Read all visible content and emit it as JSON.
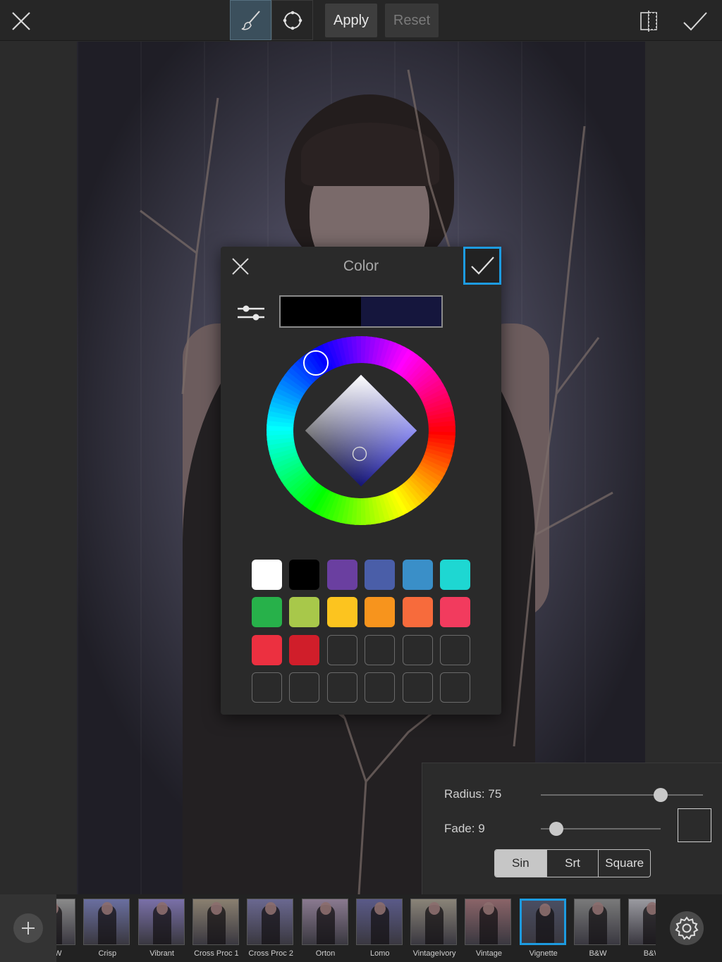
{
  "toolbar": {
    "apply_label": "Apply",
    "reset_label": "Reset",
    "active_tool": "brush-icon"
  },
  "color_dialog": {
    "title": "Color",
    "old_color": "#000000",
    "new_color": "#15163d",
    "swatches": [
      "#ffffff",
      "#000000",
      "#6a3fa0",
      "#4a5ea8",
      "#3a8fc8",
      "#1ed7d2",
      "#27b14a",
      "#a8c84a",
      "#fcc41f",
      "#f7941d",
      "#f76b3c",
      "#f23b5e",
      "#ec3040",
      "#d01e2a",
      "",
      "",
      "",
      "",
      "",
      "",
      "",
      "",
      "",
      ""
    ]
  },
  "settings": {
    "radius_label": "Radius: 75",
    "radius_value": 75,
    "fade_label": "Fade: 9",
    "fade_value": 9,
    "modes": [
      "Sin",
      "Srt",
      "Square"
    ],
    "active_mode": "Sin"
  },
  "filters": [
    {
      "label": "B&W"
    },
    {
      "label": "Crisp"
    },
    {
      "label": "Vibrant"
    },
    {
      "label": "Cross Proc 1"
    },
    {
      "label": "Cross Proc 2"
    },
    {
      "label": "Orton"
    },
    {
      "label": "Lomo"
    },
    {
      "label": "VintageIvory"
    },
    {
      "label": "Vintage"
    },
    {
      "label": "Vignette",
      "selected": true
    },
    {
      "label": "B&W"
    },
    {
      "label": "B&W"
    }
  ],
  "colors": {
    "accent": "#1d9be0"
  }
}
